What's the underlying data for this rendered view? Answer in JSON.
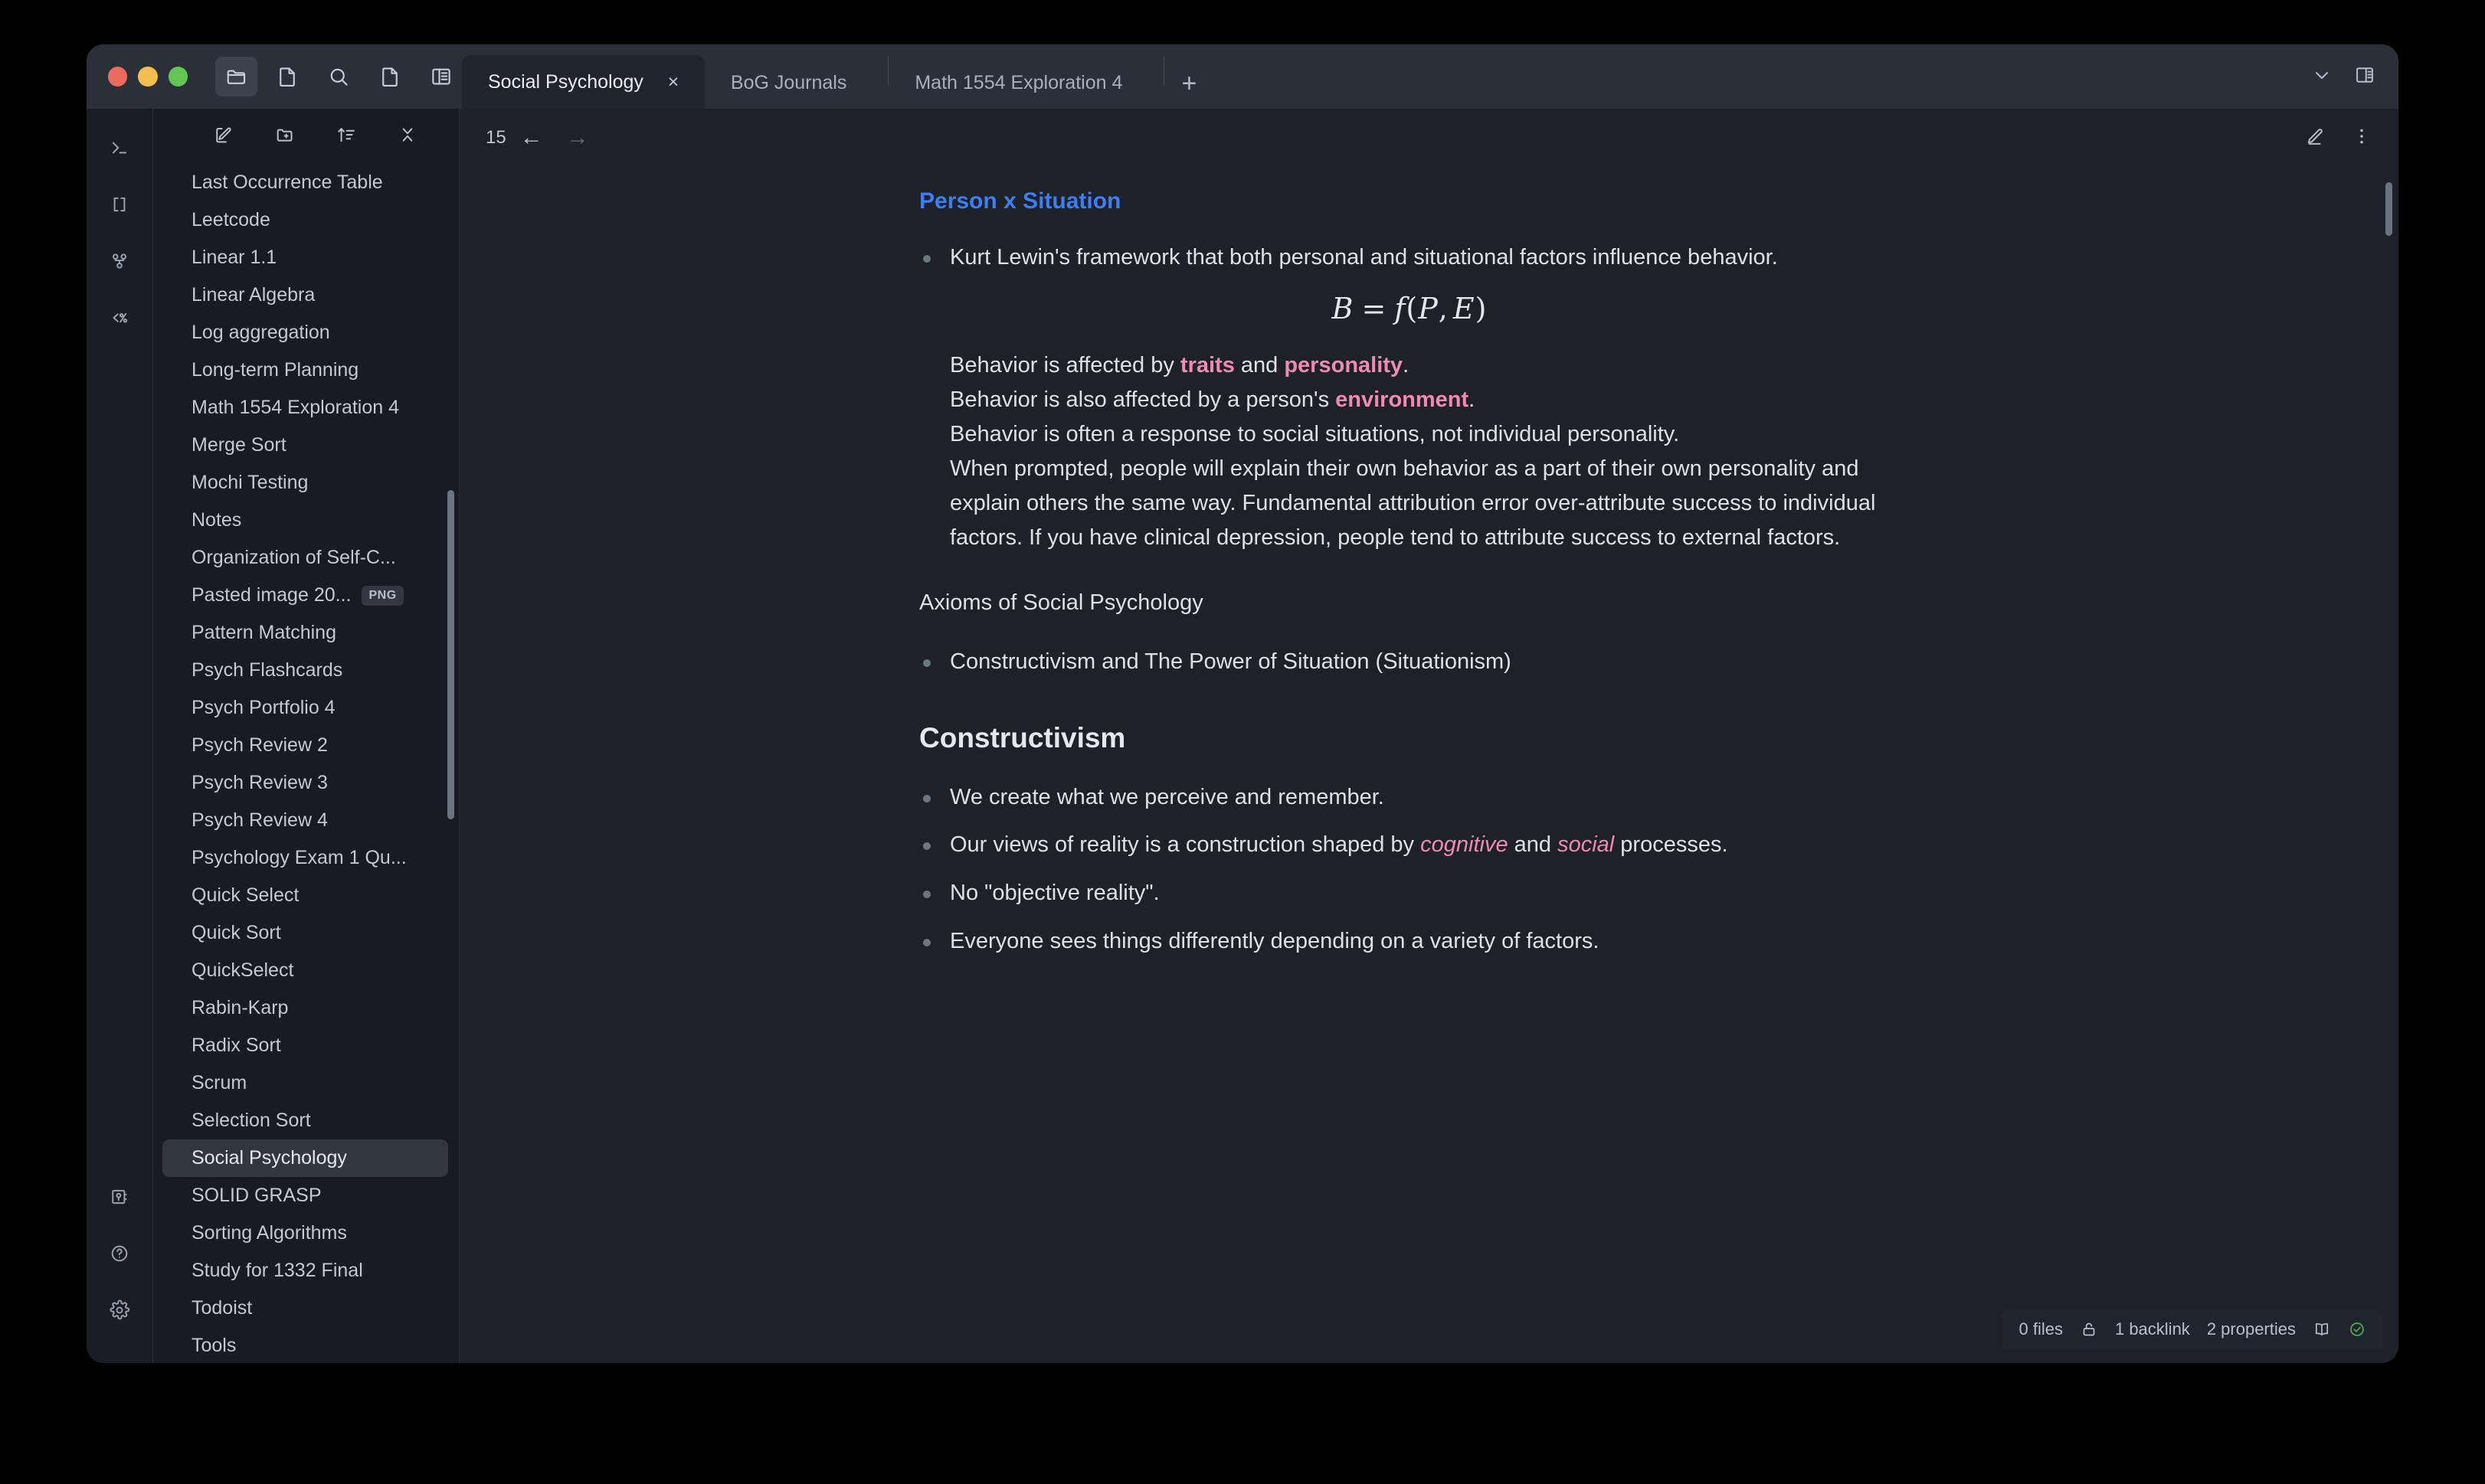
{
  "window": {
    "traffic_lights": [
      "close",
      "minimize",
      "maximize"
    ],
    "toolbar_icons": [
      "folder-icon",
      "file-icon",
      "search-icon",
      "page-icon",
      "sidebar-layout-icon"
    ],
    "right_icons": [
      "chevron-down-icon",
      "right-panel-icon"
    ]
  },
  "tabs": [
    {
      "label": "Social Psychology",
      "active": true,
      "close": "×"
    },
    {
      "label": "BoG Journals",
      "active": false
    },
    {
      "label": "Math 1554 Exploration 4",
      "active": false
    }
  ],
  "new_tab_label": "+",
  "rail": {
    "top_icons": [
      "terminal-icon",
      "brackets-icon",
      "graph-icon",
      "template-icon"
    ],
    "bottom_icons": [
      "keychain-icon",
      "help-icon",
      "settings-icon"
    ]
  },
  "sidebar": {
    "toolbar_icons": [
      "new-note-icon",
      "new-folder-icon",
      "sort-icon",
      "collapse-all-icon"
    ],
    "items": [
      {
        "label": "Last Occurrence Table"
      },
      {
        "label": "Leetcode"
      },
      {
        "label": "Linear 1.1"
      },
      {
        "label": "Linear Algebra"
      },
      {
        "label": "Log aggregation"
      },
      {
        "label": "Long-term Planning"
      },
      {
        "label": "Math 1554 Exploration 4"
      },
      {
        "label": "Merge Sort"
      },
      {
        "label": "Mochi Testing"
      },
      {
        "label": "Notes"
      },
      {
        "label": "Organization of Self-C..."
      },
      {
        "label": "Pasted image 20...",
        "badge": "PNG"
      },
      {
        "label": "Pattern Matching"
      },
      {
        "label": "Psych Flashcards"
      },
      {
        "label": "Psych Portfolio 4"
      },
      {
        "label": "Psych Review 2"
      },
      {
        "label": "Psych Review 3"
      },
      {
        "label": "Psych Review 4"
      },
      {
        "label": "Psychology Exam 1 Qu..."
      },
      {
        "label": "Quick Select"
      },
      {
        "label": "Quick Sort"
      },
      {
        "label": "QuickSelect"
      },
      {
        "label": "Rabin-Karp"
      },
      {
        "label": "Radix Sort"
      },
      {
        "label": "Scrum"
      },
      {
        "label": "Selection Sort"
      },
      {
        "label": "Social Psychology",
        "selected": true
      },
      {
        "label": "SOLID GRASP"
      },
      {
        "label": "Sorting Algorithms"
      },
      {
        "label": "Study for 1332 Final"
      },
      {
        "label": "Todoist"
      },
      {
        "label": "Tools"
      }
    ]
  },
  "note_toolbar": {
    "word_count": "15",
    "back_arrow": "←",
    "forward_arrow": "→",
    "right_icons": [
      "edit-pencil-icon",
      "more-options-icon"
    ]
  },
  "document": {
    "heading_blue": "Person x Situation",
    "bullet_1": "Kurt Lewin's framework that both personal and situational factors influence behavior.",
    "formula": "B = f(P, E)",
    "formula_parts": {
      "lhs": "B",
      "eq": "=",
      "fn": "f",
      "open": "(",
      "p": "P",
      "comma": ",",
      "e": "E",
      "close": ")"
    },
    "line_1_pre": "Behavior is affected by ",
    "line_1_term_a": "traits",
    "line_1_mid": " and ",
    "line_1_term_b": "personality",
    "line_1_post": ".",
    "line_2_pre": "Behavior is also affected by a person's ",
    "line_2_term": "environment",
    "line_2_post": ".",
    "line_3": "Behavior is often a response to social situations, not individual personality.",
    "line_4": "When prompted, people will explain their own behavior as a part of their own personality and explain others the same way. Fundamental attribution error over-attribute success to individual factors. If you have clinical depression, people tend to attribute success to external factors.",
    "axioms_line": "Axioms of Social Psychology",
    "bullet_2": "Constructivism and The Power of Situation (Situationism)",
    "heading_constructivism": "Constructivism",
    "bullet_3": "We create what we perceive and remember.",
    "bullet_4_pre": "Our views of reality is a construction shaped by ",
    "bullet_4_term_a": "cognitive",
    "bullet_4_mid": " and ",
    "bullet_4_term_b": "social",
    "bullet_4_post": " processes.",
    "bullet_5": "No \"objective reality\".",
    "bullet_6": "Everyone sees things differently depending on a variety of factors."
  },
  "status_bar": {
    "files": "0 files",
    "lock_icon": "unlock-icon",
    "backlinks": "1 backlink",
    "properties": "2 properties",
    "book_icon": "book-icon",
    "sync_icon": "sync-ok-icon"
  },
  "colors": {
    "accent_blue": "#3b7ff5",
    "highlight_pink": "#ef8ab0",
    "window_bg": "#1e2128",
    "sidebar_bg": "#181b21",
    "titlebar_bg": "#2b2f38",
    "sync_green": "#4caf50"
  }
}
